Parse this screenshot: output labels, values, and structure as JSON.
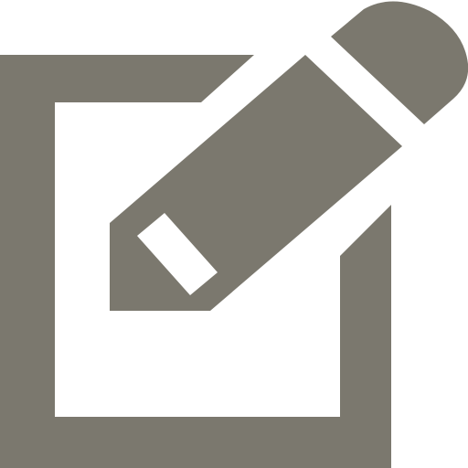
{
  "icon": {
    "name": "edit-icon",
    "color": "#7b786e",
    "background": "#ffffff"
  }
}
